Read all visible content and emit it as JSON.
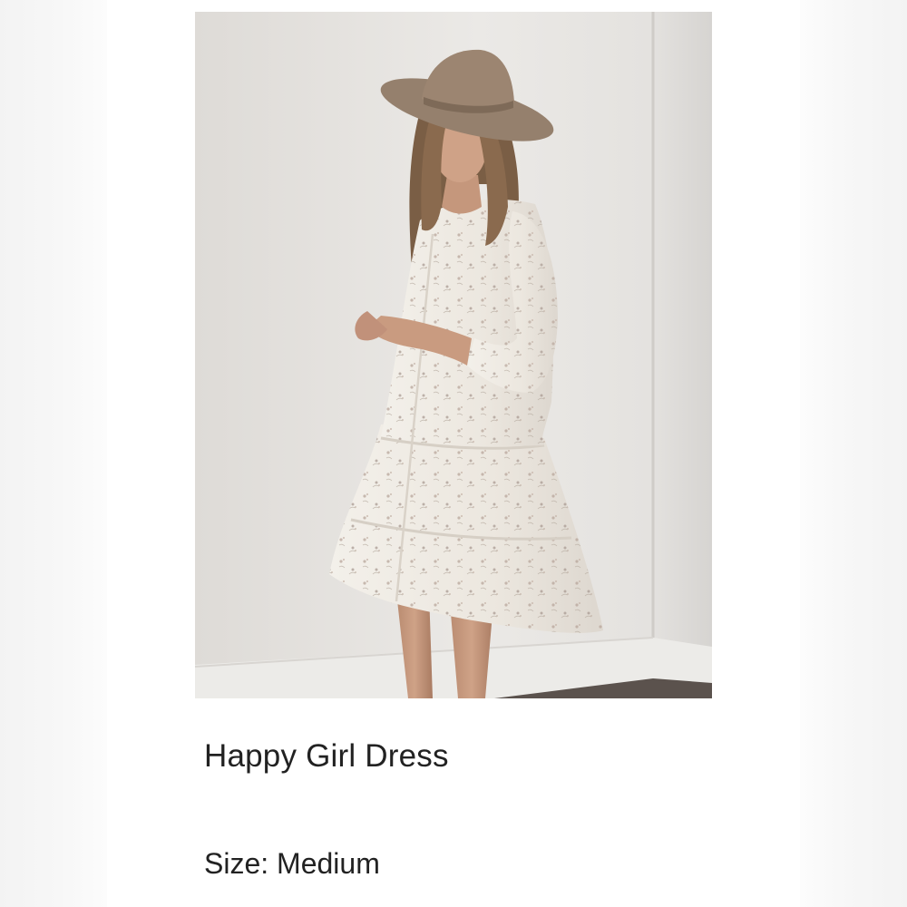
{
  "product": {
    "image_alt": "Model wearing a white floral tiered shirt dress and a brown wide-brim hat",
    "name": "Happy Girl Dress",
    "size_line": "Size: Medium"
  },
  "colors": {
    "wall": "#e7e5e2",
    "hat": "#9c8571",
    "dress": "#efebe4",
    "floral_print": "#b3a39a",
    "hair": "#7a5e45",
    "skin": "#c99b80",
    "floor": "#5b524d",
    "text": "#222222"
  }
}
